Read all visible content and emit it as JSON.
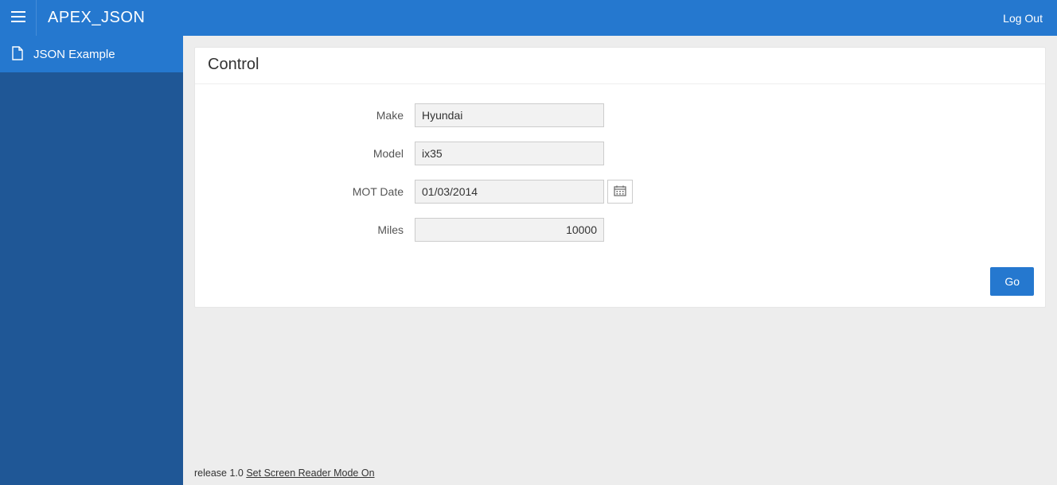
{
  "header": {
    "app_title": "APEX_JSON",
    "logout": "Log Out"
  },
  "sidebar": {
    "items": [
      {
        "label": "JSON Example"
      }
    ]
  },
  "region": {
    "title": "Control",
    "fields": {
      "make": {
        "label": "Make",
        "value": "Hyundai"
      },
      "model": {
        "label": "Model",
        "value": "ix35"
      },
      "mot_date": {
        "label": "MOT Date",
        "value": "01/03/2014"
      },
      "miles": {
        "label": "Miles",
        "value": "10000"
      }
    },
    "go_label": "Go"
  },
  "footer": {
    "release_prefix": "release 1.0 ",
    "screen_reader_link": "Set Screen Reader Mode On"
  }
}
